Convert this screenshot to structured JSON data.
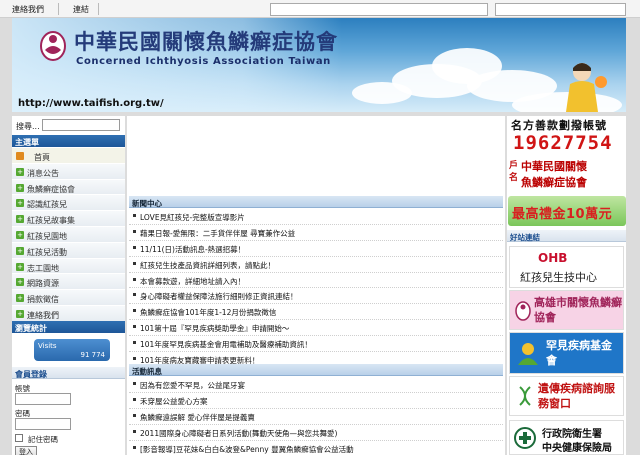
{
  "topbar": {
    "links": [
      "連絡我們",
      "連結"
    ]
  },
  "banner": {
    "title_zh": "中華民國關懷魚鱗癬症協會",
    "title_en": "Concerned Ichthyosis Association Taiwan",
    "url": "http://www.taifish.org.tw/"
  },
  "sidebar": {
    "search_label": "搜尋...",
    "menu_title": "主選單",
    "home": "首頁",
    "items": [
      {
        "label": "消息公告"
      },
      {
        "label": "魚鱗癬症協會"
      },
      {
        "label": "認識紅孩兒"
      },
      {
        "label": "紅孩兒故事集"
      },
      {
        "label": "紅孩兒園地"
      },
      {
        "label": "紅孩兒活動"
      },
      {
        "label": "志工園地"
      },
      {
        "label": "網路資源"
      },
      {
        "label": "捐款徵信"
      },
      {
        "label": "連絡我們"
      }
    ],
    "stats_title": "瀏覽統計",
    "visits_label": "Visits",
    "visits_value": "91 774",
    "login_title": "會員登錄",
    "username_label": "帳號",
    "password_label": "密碼",
    "remember_label": "記住密碼",
    "login_button": "登入"
  },
  "center": {
    "news_title": "新聞中心",
    "news": [
      "LOVE見紅孩兒-完整版宣導影片",
      "藉果日報-愛無限：二手貨伴伴屋 尋寶兼作公益",
      "11/11(日)活動訊息-熱選招募！",
      "紅孩兒生技產品資訊詳細列表，請點此！",
      "本會募款遊，詳細地址請入內！",
      "身心障礙者權益保障法施行細則修正資訊連結！",
      "魚鱗癬症協會101年度1-12月份捐款徵信",
      "101第十屆『罕見疾病獎助學金』申請開始〜",
      "101年度罕見疾病基金會用電補助及醫療補助資訊！",
      "101年度病友寶藏審申請表更新料！"
    ],
    "events_title": "活動訊息",
    "events": [
      "因為有您愛不罕見，公益尾牙宴",
      "禾穿屋公益愛心方案",
      "魚鱗癬遠誤解 愛心伴伴屋是提義賣",
      "2011國際身心障礙者日系列活動(舞動天使角—與您共舞愛)",
      "[影音報導]豆花妹&白白&波登&Penny 豐翼魚鱗癬協會公益活動"
    ]
  },
  "rightcol": {
    "account_title": "名方善款劃撥帳號",
    "account_number": "19627754",
    "account_side": "戶名",
    "account_org_line1": "中華民國關懷",
    "account_org_line2": "魚鱗癬症協會",
    "birthday_text": "最高禮金10萬元",
    "friends_title": "好站連結",
    "links": [
      {
        "name": "OHB",
        "label": "紅孩兒生技中心"
      },
      {
        "name": "kaohsiung",
        "label": "高雄市關懷魚鱗癬協會"
      },
      {
        "name": "rare",
        "label": "罕見疾病基金會"
      },
      {
        "name": "genetic",
        "label": "遺傳疾病諮詢服務窗口"
      },
      {
        "name": "nhi-line1",
        "label": "行政院衛生署"
      },
      {
        "name": "nhi-line2",
        "label": "中央健康保險局"
      }
    ]
  },
  "colors": {
    "menu_blue": "#1d5698",
    "accent_red": "#d01515",
    "menu_green": "#55a832"
  }
}
